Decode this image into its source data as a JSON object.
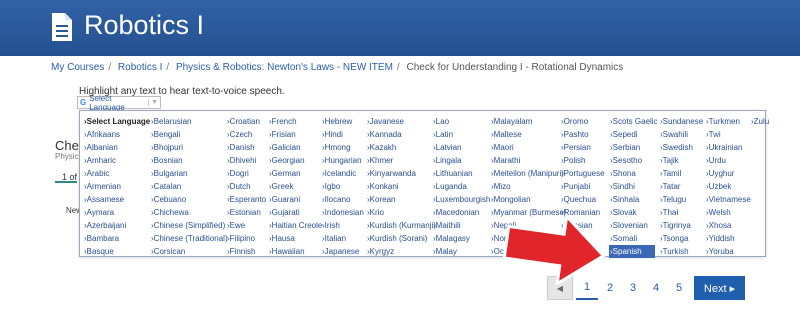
{
  "header": {
    "title": "Robotics I"
  },
  "breadcrumb": [
    "My Courses",
    "Robotics I",
    "Physics & Robotics: Newton's Laws - NEW ITEM",
    "Check for Understanding I - Rotational Dynamics"
  ],
  "hint": "Highlight any text to hear text-to-voice speech.",
  "translate": {
    "label": "Select Language",
    "logo": "G",
    "arrow": "▼"
  },
  "background": {
    "heading": "Chec",
    "sub": "Physic",
    "counter": "1 of",
    "newline": "New"
  },
  "languages": [
    [
      "›Select Language",
      "›Afrikaans",
      "›Albanian",
      "›Amharic",
      "›Arabic",
      "›Armenian",
      "›Assamese",
      "›Aymara",
      "›Azerbaijani",
      "›Bambara",
      "›Basque"
    ],
    [
      "›Belarusian",
      "›Bengali",
      "›Bhojpuri",
      "›Bosnian",
      "›Bulgarian",
      "›Catalan",
      "›Cebuano",
      "›Chichewa",
      "›Chinese (Simplified)",
      "›Chinese (Traditional)",
      "›Corsican"
    ],
    [
      "›Croatian",
      "›Czech",
      "›Danish",
      "›Dhivehi",
      "›Dogri",
      "›Dutch",
      "›Esperanto",
      "›Estonian",
      "›Ewe",
      "›Filipino",
      "›Finnish"
    ],
    [
      "›French",
      "›Frisian",
      "›Galician",
      "›Georgian",
      "›German",
      "›Greek",
      "›Guarani",
      "›Gujarati",
      "›Haitian Creole",
      "›Hausa",
      "›Hawaiian"
    ],
    [
      "›Hebrew",
      "›Hindi",
      "›Hmong",
      "›Hungarian",
      "›Icelandic",
      "›Igbo",
      "›Ilocano",
      "›Indonesian",
      "›Irish",
      "›Italian",
      "›Japanese"
    ],
    [
      "›Javanese",
      "›Kannada",
      "›Kazakh",
      "›Khmer",
      "›Kinyarwanda",
      "›Konkani",
      "›Korean",
      "›Krio",
      "›Kurdish (Kurmanji)",
      "›Kurdish (Sorani)",
      "›Kyrgyz"
    ],
    [
      "›Lao",
      "›Latin",
      "›Latvian",
      "›Lingala",
      "›Lithuanian",
      "›Luganda",
      "›Luxembourgish",
      "›Macedonian",
      "›Maithili",
      "›Malagasy",
      "›Malay"
    ],
    [
      "›Malayalam",
      "›Maltese",
      "›Maori",
      "›Marathi",
      "›Meiteilon (Manipuri)",
      "›Mizo",
      "›Mongolian",
      "›Myanmar (Burmese)",
      "›Nepali",
      "›Norwegian",
      "›Oc"
    ],
    [
      "›Oromo",
      "›Pashto",
      "›Persian",
      "›Polish",
      "›Portuguese",
      "›Punjabi",
      "›Quechua",
      "›Romanian",
      "›Russian",
      "›S",
      ""
    ],
    [
      "›Scots Gaelic",
      "›Sepedi",
      "›Serbian",
      "›Sesotho",
      "›Shona",
      "›Sindhi",
      "›Sinhala",
      "›Slovak",
      "›Slovenian",
      "›Somali",
      "›Spanish"
    ],
    [
      "›Sundanese",
      "›Swahili",
      "›Swedish",
      "›Tajik",
      "›Tamil",
      "›Tatar",
      "›Telugu",
      "›Thai",
      "›Tigrinya",
      "›Tsonga",
      "›Turkish"
    ],
    [
      "›Turkmen",
      "›Twi",
      "›Ukrainian",
      "›Urdu",
      "›Uyghur",
      "›Uzbek",
      "›Vietnamese",
      "›Welsh",
      "›Xhosa",
      "›Yiddish",
      "›Yoruba"
    ],
    [
      "›Zulu"
    ]
  ],
  "selected_language": "›Spanish",
  "pagination": {
    "prev": "◀",
    "pages": [
      "1",
      "2",
      "3",
      "4",
      "5"
    ],
    "current": "1",
    "next": "Next ▸"
  },
  "colors": {
    "header": "#2b5797",
    "link": "#2a5ea8",
    "selected": "#3b68b6",
    "arrow": "#e0262a"
  }
}
